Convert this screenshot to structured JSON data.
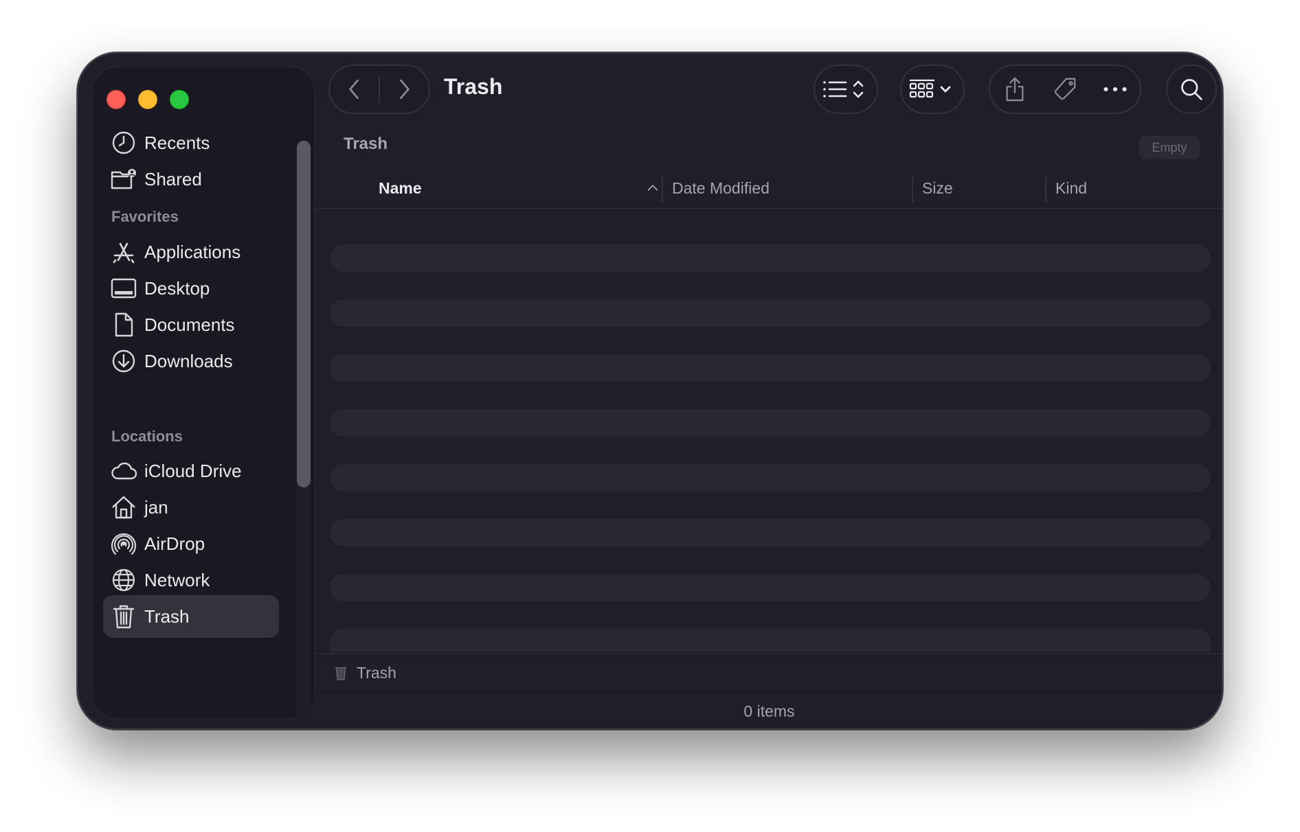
{
  "window": {
    "title": "Trash",
    "path_title": "Trash",
    "empty_button": "Empty"
  },
  "sidebar": {
    "top_items": [
      {
        "label": "Recents",
        "icon": "clock-icon"
      },
      {
        "label": "Shared",
        "icon": "shared-folder-icon"
      }
    ],
    "favorites_heading": "Favorites",
    "favorites": [
      {
        "label": "Applications",
        "icon": "applications-icon"
      },
      {
        "label": "Desktop",
        "icon": "desktop-icon"
      },
      {
        "label": "Documents",
        "icon": "document-icon"
      },
      {
        "label": "Downloads",
        "icon": "download-icon"
      }
    ],
    "locations_heading": "Locations",
    "locations": [
      {
        "label": "iCloud Drive",
        "icon": "cloud-icon"
      },
      {
        "label": "jan",
        "icon": "home-icon"
      },
      {
        "label": "AirDrop",
        "icon": "airdrop-icon"
      },
      {
        "label": "Network",
        "icon": "globe-icon"
      },
      {
        "label": "Trash",
        "icon": "trash-icon",
        "selected": true
      }
    ]
  },
  "columns": {
    "name": "Name",
    "date_modified": "Date Modified",
    "size": "Size",
    "kind": "Kind"
  },
  "pathbar": {
    "label": "Trash"
  },
  "status": {
    "items": "0 items"
  },
  "colors": {
    "close": "#ff5f57",
    "minimize": "#febc2e",
    "maximize": "#28c840",
    "window_bg": "#211e2a"
  }
}
